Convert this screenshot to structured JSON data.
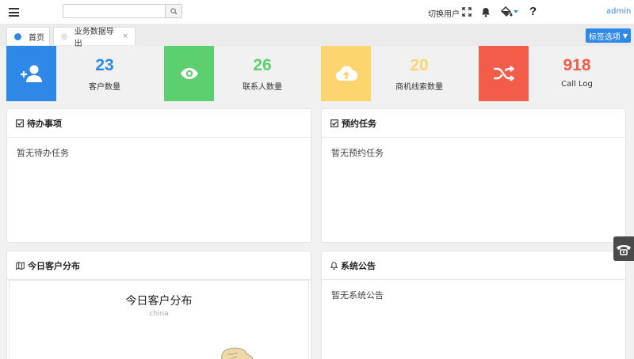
{
  "header": {
    "search": {
      "value": "",
      "placeholder": ""
    },
    "switch_user": "切换用户",
    "help": "?",
    "user": "admin"
  },
  "tabs": [
    {
      "label": "首页",
      "dot_color": "#2f88e8",
      "active": true
    },
    {
      "label": "业务数据导出",
      "dot_color": "#e5e5e5",
      "active": false,
      "close": "×"
    }
  ],
  "tag_options": {
    "label": "标签选项",
    "caret": "▼"
  },
  "stats": [
    {
      "value": "23",
      "label": "客户数量",
      "color": "#2f88e8",
      "icon": "add-user-icon"
    },
    {
      "value": "26",
      "label": "联系人数量",
      "color": "#5ccf6e",
      "icon": "eye-icon"
    },
    {
      "value": "20",
      "label": "商机线索数量",
      "color": "#fdd56e",
      "icon": "cloud-upload-icon"
    },
    {
      "value": "918",
      "label": "Call Log",
      "color": "#f25c48",
      "icon": "shuffle-icon"
    }
  ],
  "panels": {
    "todo": {
      "title": "待办事项",
      "empty": "暂无待办任务"
    },
    "appointment": {
      "title": "预约任务",
      "empty": "暂无预约任务"
    },
    "distribution": {
      "title": "今日客户分布",
      "chart_title": "今日客户分布",
      "chart_subtitle": "china"
    },
    "announcement": {
      "title": "系统公告",
      "empty": "暂无系统公告"
    }
  }
}
